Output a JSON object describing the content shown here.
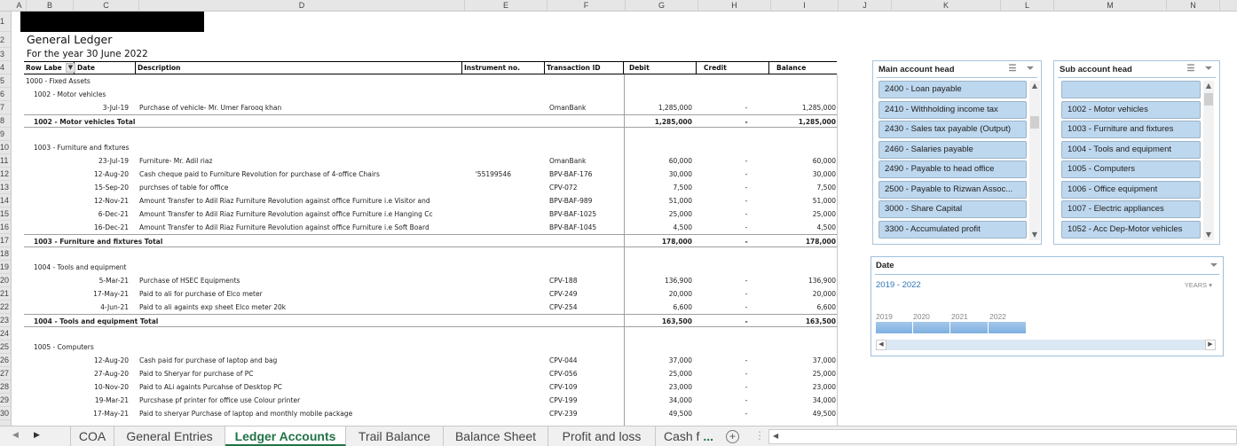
{
  "columns": [
    "A",
    "B",
    "C",
    "D",
    "E",
    "F",
    "G",
    "H",
    "I",
    "J",
    "K",
    "L",
    "M",
    "N"
  ],
  "row_numbers": [
    "1",
    "2",
    "3",
    "4",
    "5",
    "6",
    "7",
    "8",
    "9",
    "10",
    "11",
    "12",
    "13",
    "14",
    "15",
    "16",
    "17",
    "18",
    "19",
    "20",
    "21",
    "22",
    "23",
    "24",
    "25",
    "26",
    "27",
    "28",
    "29",
    "30"
  ],
  "report": {
    "title": "General Ledger",
    "subtitle": "For the year 30 June 2022"
  },
  "table": {
    "headers": {
      "row_labels": "Row Labe",
      "filter_icon": "▼",
      "date": "Date",
      "description": "Description",
      "instrument": "Instrument no.",
      "transaction": "Transaction ID",
      "debit": "Debit",
      "credit": "Credit",
      "balance": "Balance"
    },
    "rows": [
      {
        "type": "group",
        "label": "1000 - Fixed Assets"
      },
      {
        "type": "sub",
        "label": "1002 - Motor vehicles"
      },
      {
        "type": "entry",
        "date": "3-Jul-19",
        "desc": "Purchase of vehicle- Mr. Umer Farooq khan",
        "inst": "",
        "txn": "OmanBank",
        "debit": "1,285,000",
        "credit": "-",
        "balance": "1,285,000"
      },
      {
        "type": "total",
        "label": "1002 - Motor vehicles Total",
        "debit": "1,285,000",
        "credit": "-",
        "balance": "1,285,000"
      },
      {
        "type": "blank"
      },
      {
        "type": "sub",
        "label": "1003 - Furniture and fixtures"
      },
      {
        "type": "entry",
        "date": "23-Jul-19",
        "desc": "Furniture- Mr. Adil riaz",
        "inst": "",
        "txn": "OmanBank",
        "debit": "60,000",
        "credit": "-",
        "balance": "60,000"
      },
      {
        "type": "entry",
        "date": "12-Aug-20",
        "desc": "Cash cheque paid to Furniture Revolution for purchase of 4-office Chairs",
        "inst": "'55199546",
        "txn": "BPV-BAF-176",
        "debit": "30,000",
        "credit": "-",
        "balance": "30,000"
      },
      {
        "type": "entry",
        "date": "15-Sep-20",
        "desc": "purchses of table for office",
        "inst": "",
        "txn": "CPV-072",
        "debit": "7,500",
        "credit": "-",
        "balance": "7,500"
      },
      {
        "type": "entry",
        "date": "12-Nov-21",
        "desc": "Amount Transfer to Adil Riaz Furniture Revolution against office Furniture i.e Visitor and",
        "inst": "",
        "txn": "BPV-BAF-989",
        "debit": "51,000",
        "credit": "-",
        "balance": "51,000"
      },
      {
        "type": "entry",
        "date": "6-Dec-21",
        "desc": "Amount Transfer to Adil Riaz Furniture Revolution against office Furniture i.e Hanging Cc",
        "inst": "",
        "txn": "BPV-BAF-1025",
        "debit": "25,000",
        "credit": "-",
        "balance": "25,000"
      },
      {
        "type": "entry",
        "date": "16-Dec-21",
        "desc": "Amount Transfer to Adil Riaz Furniture Revolution against office Furniture i.e Soft Board",
        "inst": "",
        "txn": "BPV-BAF-1045",
        "debit": "4,500",
        "credit": "-",
        "balance": "4,500"
      },
      {
        "type": "total",
        "label": "1003 - Furniture and fixtures Total",
        "debit": "178,000",
        "credit": "-",
        "balance": "178,000"
      },
      {
        "type": "blank"
      },
      {
        "type": "sub",
        "label": "1004 - Tools and equipment"
      },
      {
        "type": "entry",
        "date": "5-Mar-21",
        "desc": "Purchase of HSEC Equipments",
        "inst": "",
        "txn": "CPV-188",
        "debit": "136,900",
        "credit": "-",
        "balance": "136,900"
      },
      {
        "type": "entry",
        "date": "17-May-21",
        "desc": "Paid to ali for purchase of Elco meter",
        "inst": "",
        "txn": "CPV-249",
        "debit": "20,000",
        "credit": "-",
        "balance": "20,000"
      },
      {
        "type": "entry",
        "date": "4-Jun-21",
        "desc": "Paid to ali  againts exp sheet Elco meter 20k",
        "inst": "",
        "txn": "CPV-254",
        "debit": "6,600",
        "credit": "-",
        "balance": "6,600"
      },
      {
        "type": "total",
        "label": "1004 - Tools and equipment Total",
        "debit": "163,500",
        "credit": "-",
        "balance": "163,500"
      },
      {
        "type": "blank"
      },
      {
        "type": "sub",
        "label": "1005 - Computers"
      },
      {
        "type": "entry",
        "date": "12-Aug-20",
        "desc": "Cash paid for purchase of laptop and bag",
        "inst": "",
        "txn": "CPV-044",
        "debit": "37,000",
        "credit": "-",
        "balance": "37,000"
      },
      {
        "type": "entry",
        "date": "27-Aug-20",
        "desc": "Paid to Sheryar for purchase of PC",
        "inst": "",
        "txn": "CPV-056",
        "debit": "25,000",
        "credit": "-",
        "balance": "25,000"
      },
      {
        "type": "entry",
        "date": "10-Nov-20",
        "desc": "Paid to ALi againts Purcahse of Desktop PC",
        "inst": "",
        "txn": "CPV-109",
        "debit": "23,000",
        "credit": "-",
        "balance": "23,000"
      },
      {
        "type": "entry",
        "date": "19-Mar-21",
        "desc": "Purcshase pf printer for office use Colour printer",
        "inst": "",
        "txn": "CPV-199",
        "debit": "34,000",
        "credit": "-",
        "balance": "34,000"
      },
      {
        "type": "entry",
        "date": "17-May-21",
        "desc": "Paid to sheryar Purchase of laptop and monthly mobile package",
        "inst": "",
        "txn": "CPV-239",
        "debit": "49,500",
        "credit": "-",
        "balance": "49,500"
      }
    ]
  },
  "slicers": {
    "main": {
      "title": "Main account head",
      "multiselect_icon": "☰",
      "clear_filter_icon": "⏷",
      "items": [
        "2400 - Loan payable",
        "2410 - Withholding income tax",
        "2430 - Sales tax payable (Output)",
        "2460 - Salaries payable",
        "2490 - Payable to head office",
        "2500 - Payable to Rizwan Assoc...",
        "3000 - Share Capital",
        "3300 - Accumulated profit"
      ]
    },
    "sub": {
      "title": "Sub account head",
      "multiselect_icon": "☰",
      "clear_filter_icon": "⏷",
      "items": [
        "",
        "1002 - Motor vehicles",
        "1003 - Furniture and fixtures",
        "1004 - Tools and equipment",
        "1005 - Computers",
        "1006 - Office equipment",
        "1007 - Electric appliances",
        "1052 - Acc Dep-Motor vehicles"
      ]
    }
  },
  "timeline": {
    "title": "Date",
    "range": "2019 - 2022",
    "level": "YEARS ▾",
    "years": [
      "2019",
      "2020",
      "2021",
      "2022"
    ],
    "left_arrow": "◀",
    "right_arrow": "▶"
  },
  "sheet_tabs": {
    "nav_prev": "◀",
    "nav_next": "▶",
    "tabs": [
      "COA",
      "General Entries",
      "Ledger Accounts",
      "Trail Balance",
      "Balance Sheet",
      "Profit and loss",
      "Cash f"
    ],
    "active": "Ledger Accounts",
    "more": "...",
    "add": "+",
    "options": "⋮",
    "scroll_left": "◀"
  }
}
